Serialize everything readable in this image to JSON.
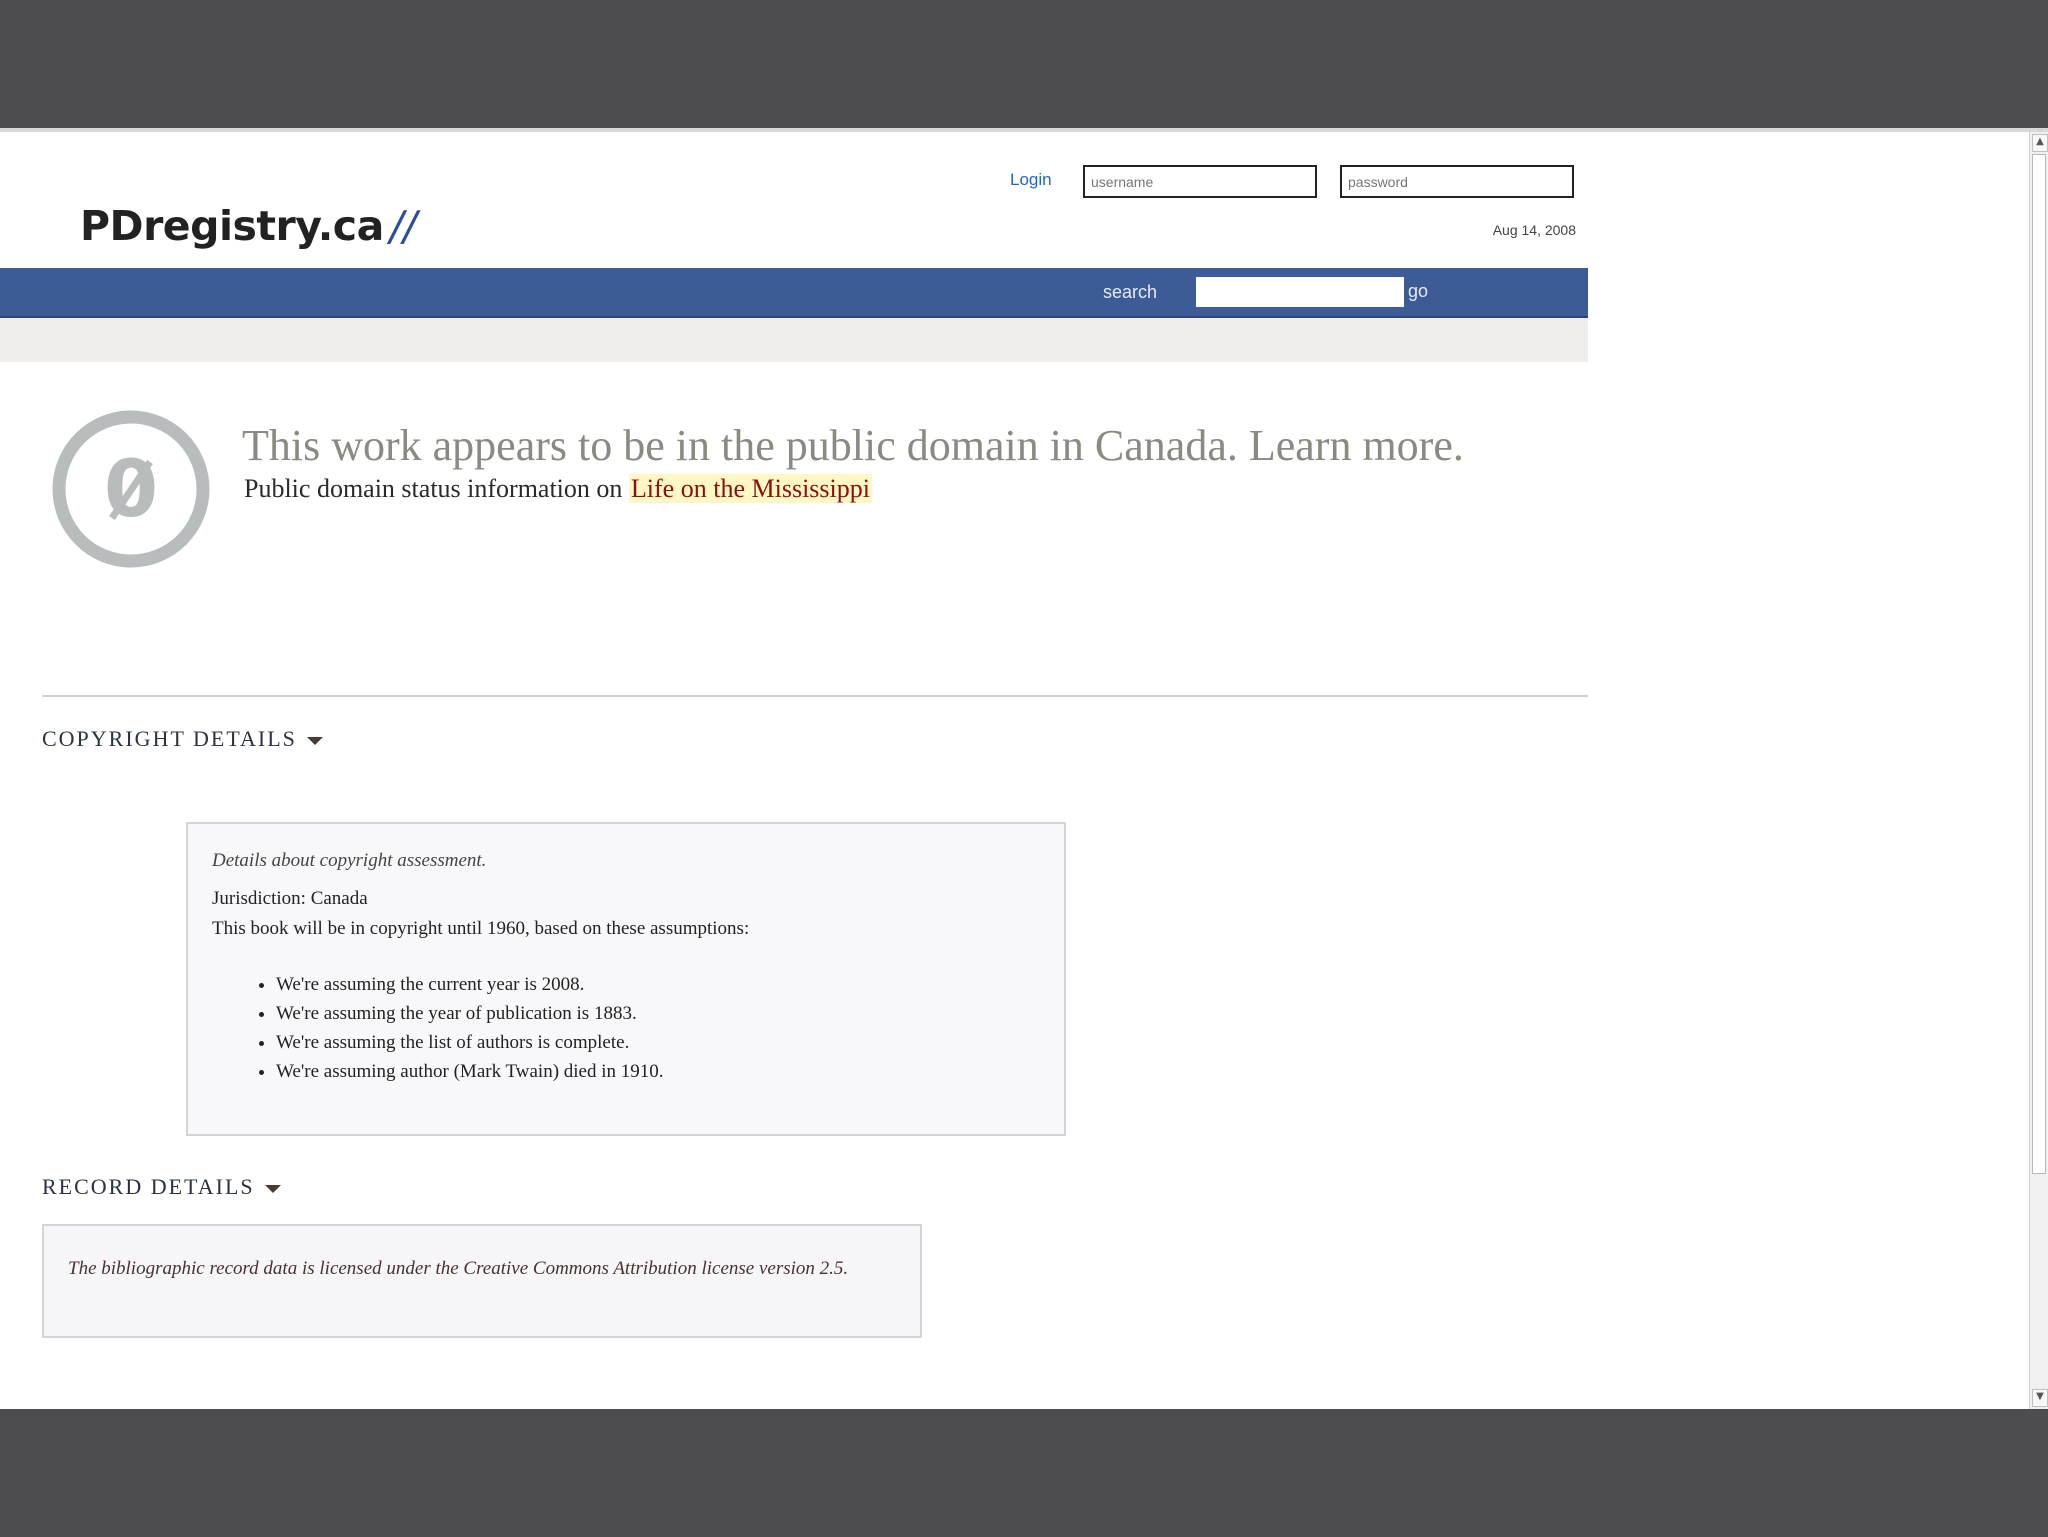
{
  "header": {
    "logo_text": "PDregistry.ca",
    "logo_suffix": "//",
    "login_label": "Login",
    "username_placeholder": "username",
    "password_placeholder": "password",
    "date": "Aug 14, 2008"
  },
  "nav": {
    "search_label": "search",
    "search_value": "",
    "go_label": "go"
  },
  "status": {
    "badge_glyph": "0",
    "headline": "This work appears to be in the public domain in Canada. Learn more.",
    "subline_prefix": "Public domain status information on ",
    "work_title": "Life on the Mississippi"
  },
  "copyright_details": {
    "heading": "COPYRIGHT DETAILS",
    "caption": "Details about copyright assessment.",
    "jurisdiction": "Jurisdiction: Canada",
    "intro": "This book will be in copyright until 1960, based on these assumptions:",
    "assumptions": [
      "We're assuming the current year is 2008.",
      "We're assuming the year of publication is 1883.",
      "We're assuming the list of authors is complete.",
      "We're assuming author (Mark Twain) died in 1910."
    ]
  },
  "record_details": {
    "heading": "RECORD DETAILS",
    "license_text": "The bibliographic record data is licensed under the Creative Commons Attribution license version 2.5."
  },
  "colors": {
    "nav_bar": "#3d5b97",
    "logo_accent": "#2e4d9c",
    "work_title": "#8a1010",
    "badge": "#b8bcbc"
  },
  "icons": {
    "badge": "public-domain-zero-icon",
    "section_toggle": "caret-down-icon"
  }
}
